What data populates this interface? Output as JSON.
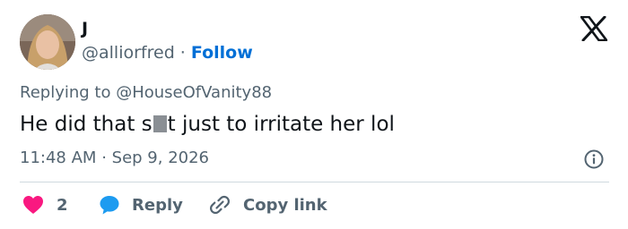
{
  "user": {
    "name": "J",
    "handle": "@alliorfred",
    "separator": "·",
    "follow_label": "Follow"
  },
  "tweet": {
    "replying_prefix": "Replying to",
    "replying_to": "@HouseOfVanity88",
    "text_before": "He did that s",
    "text_after": "t just to irritate her lol",
    "time": "11:48 AM",
    "date_separator": "·",
    "date": "Sep 9, 2026"
  },
  "actions": {
    "likes": "2",
    "reply_label": "Reply",
    "copy_label": "Copy link"
  },
  "colors": {
    "like": "#f91880",
    "reply_icon": "#1d9bf0",
    "link": "#006fd6",
    "secondary_text": "#536471",
    "primary_text": "#0f1419"
  },
  "icons": [
    "x-logo-icon",
    "heart-icon",
    "speech-bubble-icon",
    "link-icon",
    "info-icon"
  ]
}
